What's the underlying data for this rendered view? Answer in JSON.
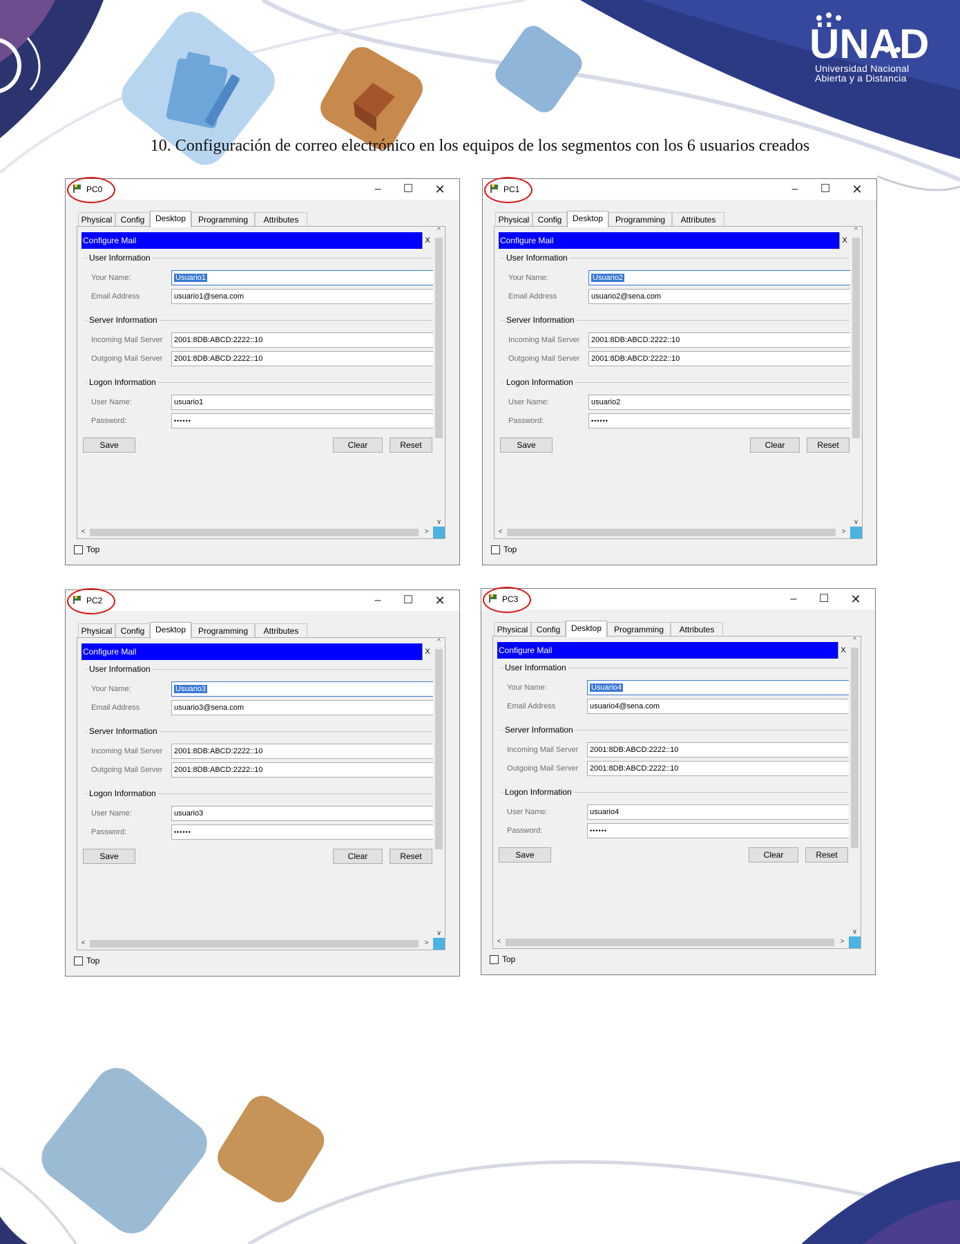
{
  "document": {
    "caption": "10. Configuración de correo electrónico en los equipos de los segmentos con los 6 usuarios creados"
  },
  "logo": {
    "title": "ÜNAD",
    "subtitle_line1": "Universidad Nacional",
    "subtitle_line2": "Abierta y a Distancia"
  },
  "colors": {
    "banner_blue": "#0000ff",
    "highlight_circle": "#dd1111",
    "selection": "#3a78d4",
    "logo_navy": "#2c3a86"
  },
  "icons": {
    "window_icon": "packet-tracer-pc-icon",
    "minimize": "minimize-icon",
    "maximize": "maximize-icon",
    "close": "close-icon",
    "checkbox": "checkbox-icon"
  },
  "windows": [
    {
      "title": "PC0",
      "tabs": [
        "Physical",
        "Config",
        "Desktop",
        "Programming",
        "Attributes"
      ],
      "active_tab": "Desktop",
      "banner": "Configure Mail",
      "banner_close": "X",
      "user_info_label": "User Information",
      "your_name_label": "Your Name:",
      "your_name": "Usuario1",
      "email_label": "Email Address",
      "email": "usuario1@sena.com",
      "server_info_label": "Server Information",
      "incoming_label": "Incoming Mail Server",
      "incoming": "2001:8DB:ABCD:2222::10",
      "outgoing_label": "Outgoing Mail Server",
      "outgoing": "2001:8DB:ABCD:2222::10",
      "logon_info_label": "Logon Information",
      "username_label": "User Name:",
      "username": "usuario1",
      "password_label": "Password:",
      "password": "••••••",
      "save": "Save",
      "clear": "Clear",
      "reset": "Reset",
      "top_label": "Top"
    },
    {
      "title": "PC1",
      "tabs": [
        "Physical",
        "Config",
        "Desktop",
        "Programming",
        "Attributes"
      ],
      "active_tab": "Desktop",
      "banner": "Configure Mail",
      "banner_close": "X",
      "user_info_label": "User Information",
      "your_name_label": "Your Name:",
      "your_name": "Usuario2",
      "email_label": "Email Address",
      "email": "usuario2@sena.com",
      "server_info_label": "Server Information",
      "incoming_label": "Incoming Mail Server",
      "incoming": "2001:8DB:ABCD:2222::10",
      "outgoing_label": "Outgoing Mail Server",
      "outgoing": "2001:8DB:ABCD:2222::10",
      "logon_info_label": "Logon Information",
      "username_label": "User Name:",
      "username": "usuario2",
      "password_label": "Password:",
      "password": "••••••",
      "save": "Save",
      "clear": "Clear",
      "reset": "Reset",
      "top_label": "Top"
    },
    {
      "title": "PC2",
      "tabs": [
        "Physical",
        "Config",
        "Desktop",
        "Programming",
        "Attributes"
      ],
      "active_tab": "Desktop",
      "banner": "Configure Mail",
      "banner_close": "X",
      "user_info_label": "User Information",
      "your_name_label": "Your Name:",
      "your_name": "Usuario3",
      "email_label": "Email Address",
      "email": "usuario3@sena.com",
      "server_info_label": "Server Information",
      "incoming_label": "Incoming Mail Server",
      "incoming": "2001:8DB:ABCD:2222::10",
      "outgoing_label": "Outgoing Mail Server",
      "outgoing": "2001:8DB:ABCD:2222::10",
      "logon_info_label": "Logon Information",
      "username_label": "User Name:",
      "username": "usuario3",
      "password_label": "Password:",
      "password": "••••••",
      "save": "Save",
      "clear": "Clear",
      "reset": "Reset",
      "top_label": "Top"
    },
    {
      "title": "PC3",
      "tabs": [
        "Physical",
        "Config",
        "Desktop",
        "Programming",
        "Attributes"
      ],
      "active_tab": "Desktop",
      "banner": "Configure Mail",
      "banner_close": "X",
      "user_info_label": "User Information",
      "your_name_label": "Your Name:",
      "your_name": "Usuario4",
      "email_label": "Email Address",
      "email": "usuario4@sena.com",
      "server_info_label": "Server Information",
      "incoming_label": "Incoming Mail Server",
      "incoming": "2001:8DB:ABCD:2222::10",
      "outgoing_label": "Outgoing Mail Server",
      "outgoing": "2001:8DB:ABCD:2222::10",
      "logon_info_label": "Logon Information",
      "username_label": "User Name:",
      "username": "usuario4",
      "password_label": "Password:",
      "password": "••••••",
      "save": "Save",
      "clear": "Clear",
      "reset": "Reset",
      "top_label": "Top"
    }
  ]
}
